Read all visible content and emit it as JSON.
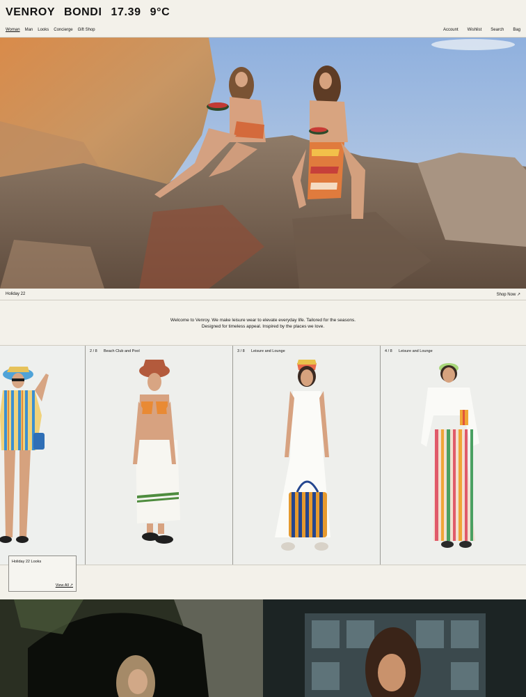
{
  "brand": {
    "name": "VENROY",
    "location": "BONDI",
    "time": "17.39",
    "temperature": "9°C"
  },
  "nav": {
    "left": [
      "Woman",
      "Man",
      "Looks",
      "Concierge",
      "Gift Shop"
    ],
    "right": [
      "Account",
      "Wishlist",
      "Search",
      "Bag"
    ]
  },
  "hero": {
    "caption": "Holiday 22",
    "cta": "Shop Now ↗"
  },
  "intro": {
    "line1": "Welcome to Venroy. We make leisure wear to elevate everyday life. Tailored for the seasons.",
    "line2": "Designed for timeless appeal. Inspired by the places we love."
  },
  "looks": {
    "panels": [
      {
        "index": "",
        "category": ""
      },
      {
        "index": "2 / 8",
        "category": "Beach Club and Pool"
      },
      {
        "index": "3 / 8",
        "category": "Leisure and Lounge"
      },
      {
        "index": "4 / 8",
        "category": "Leisure and Lounge"
      }
    ],
    "card_title": "Holiday 22 Looks",
    "card_link": "View All ↗"
  },
  "colors": {
    "background": "#f3f1ea",
    "text": "#111111",
    "divider": "#cfccc2"
  }
}
